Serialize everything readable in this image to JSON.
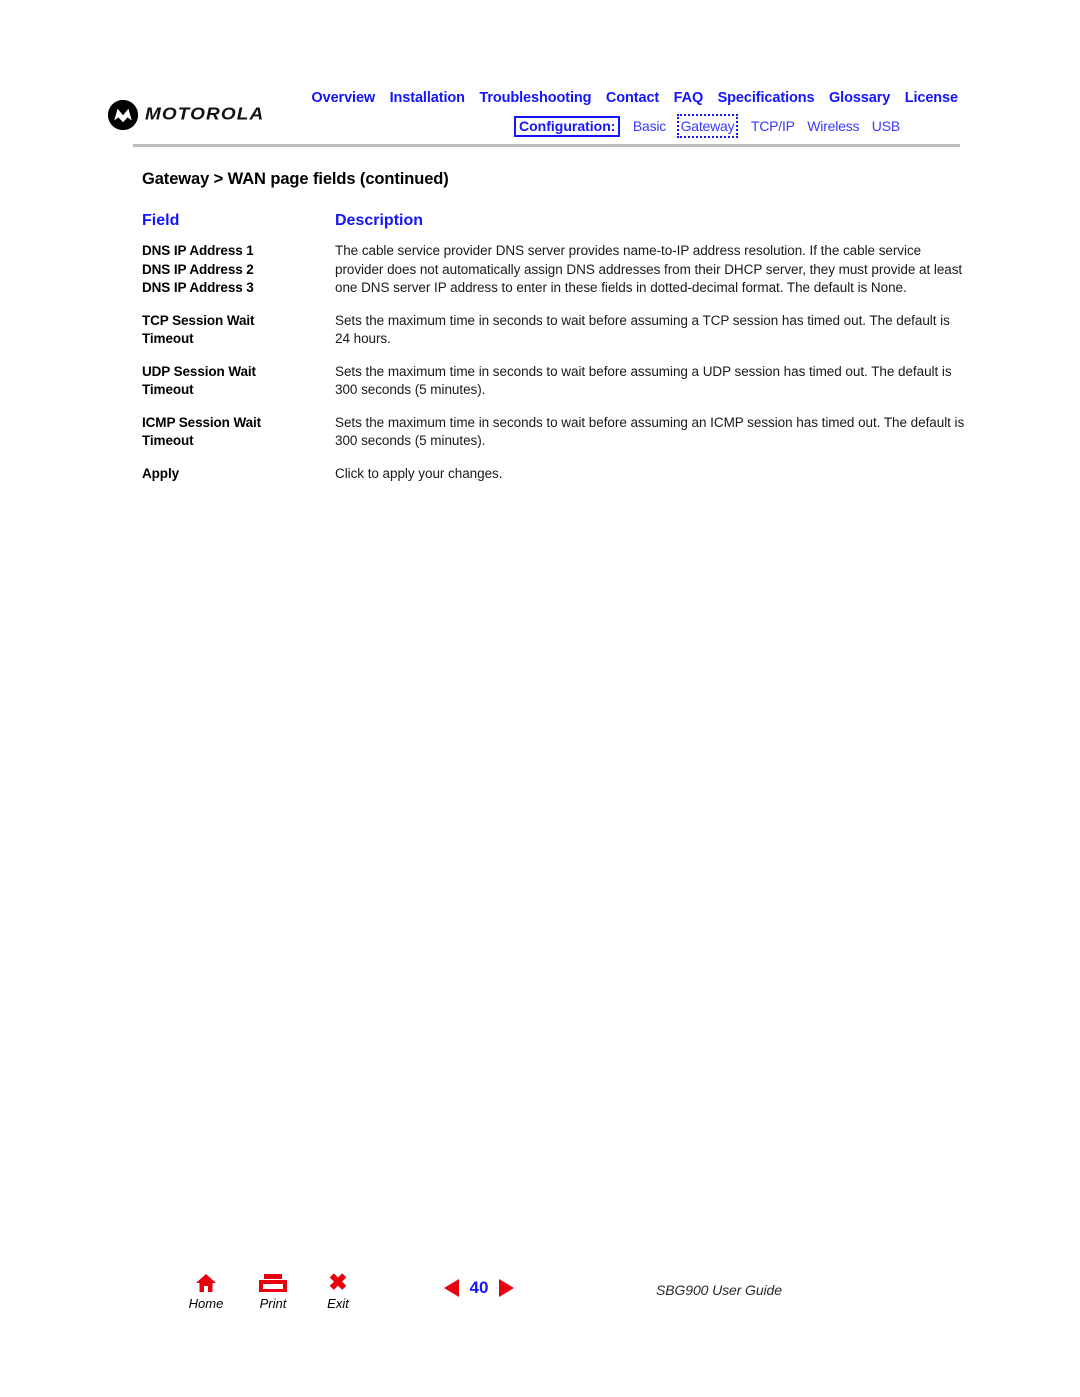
{
  "brand": {
    "name": "MOTOROLA",
    "logo_icon": "motorola-batwing-icon"
  },
  "header": {
    "primary_nav": [
      {
        "label": "Overview"
      },
      {
        "label": "Installation"
      },
      {
        "label": "Troubleshooting"
      },
      {
        "label": "Contact"
      },
      {
        "label": "FAQ"
      },
      {
        "label": "Specifications"
      },
      {
        "label": "Glossary"
      },
      {
        "label": "License"
      }
    ],
    "secondary_nav": {
      "group_label": "Configuration:",
      "items": [
        {
          "label": "Basic",
          "current": false
        },
        {
          "label": "Gateway",
          "current": true
        },
        {
          "label": "TCP/IP",
          "current": false
        },
        {
          "label": "Wireless",
          "current": false
        },
        {
          "label": "USB",
          "current": false
        }
      ]
    }
  },
  "title": "Gateway > WAN page fields (continued)",
  "table": {
    "headers": {
      "field": "Field",
      "description": "Description"
    },
    "rows": [
      {
        "field_lines": [
          "DNS IP Address 1",
          "DNS IP Address 2",
          "DNS IP Address 3"
        ],
        "description": "The cable service provider DNS server provides name-to-IP address resolution. If the cable service provider does not automatically assign DNS addresses from their DHCP server, they must provide at least one DNS server IP address to enter in these fields in dotted-decimal format. The default is None."
      },
      {
        "field_lines": [
          "TCP Session Wait",
          "Timeout"
        ],
        "description": "Sets the maximum time in seconds to wait before assuming a TCP session has timed out. The default is 24 hours."
      },
      {
        "field_lines": [
          "UDP Session Wait",
          "Timeout"
        ],
        "description": "Sets the maximum time in seconds to wait before assuming a UDP session has timed out. The default is 300 seconds (5 minutes)."
      },
      {
        "field_lines": [
          "ICMP Session Wait",
          "Timeout"
        ],
        "description": "Sets the maximum time in seconds to wait before assuming an ICMP session has timed out. The default is 300 seconds (5 minutes)."
      },
      {
        "field_lines": [
          "Apply"
        ],
        "description": "Click to apply your changes."
      }
    ]
  },
  "footer": {
    "buttons": [
      {
        "label": "Home",
        "icon": "home-icon"
      },
      {
        "label": "Print",
        "icon": "printer-icon"
      },
      {
        "label": "Exit",
        "icon": "close-x-icon"
      }
    ],
    "pager": {
      "prev_icon": "triangle-left-icon",
      "next_icon": "triangle-right-icon",
      "page_number": "40"
    },
    "guide_label": "SBG900 User Guide"
  },
  "colors": {
    "link_blue": "#1414ff",
    "accent_red": "#e8000f",
    "rule_gray": "#bcbcbc",
    "text_black": "#000000"
  }
}
